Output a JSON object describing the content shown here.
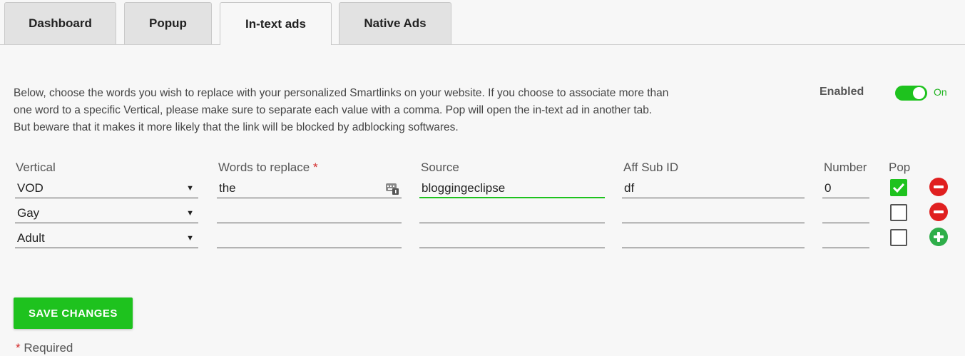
{
  "tabs": [
    {
      "label": "Dashboard",
      "active": false
    },
    {
      "label": "Popup",
      "active": false
    },
    {
      "label": "In-text ads",
      "active": true
    },
    {
      "label": "Native Ads",
      "active": false
    }
  ],
  "description": "Below, choose the words you wish to replace with your personalized Smartlinks on your website. If you choose to associate more than one word to a specific Vertical, please make sure to separate each value with a comma. Pop will open the in-text ad in another tab. But beware that it makes it more likely that the link will be blocked by adblocking softwares.",
  "enabled": {
    "label": "Enabled",
    "state_text": "On",
    "on": true
  },
  "columns": {
    "vertical": "Vertical",
    "words": "Words to replace",
    "required_mark": "*",
    "source": "Source",
    "aff_sub_id": "Aff Sub ID",
    "number": "Number",
    "pop": "Pop"
  },
  "rows": [
    {
      "vertical": "VOD",
      "words": "the",
      "source": "bloggingeclipse",
      "aff_sub_id": "df",
      "number": "0",
      "pop": true,
      "action": "remove"
    },
    {
      "vertical": "Gay",
      "words": "",
      "source": "",
      "aff_sub_id": "",
      "number": "",
      "pop": false,
      "action": "remove"
    },
    {
      "vertical": "Adult",
      "words": "",
      "source": "",
      "aff_sub_id": "",
      "number": "",
      "pop": false,
      "action": "add"
    }
  ],
  "save_label": "SAVE CHANGES",
  "required_note": "Required",
  "colors": {
    "accent": "#1ec21e",
    "remove": "#e02020",
    "add": "#2fae4a",
    "required": "#d32b2b"
  },
  "icons": {
    "dropdown": "caret-down-icon",
    "keyboard": "keyboard-icon",
    "check": "check-icon",
    "remove": "minus-circle-icon",
    "add": "plus-circle-icon"
  }
}
